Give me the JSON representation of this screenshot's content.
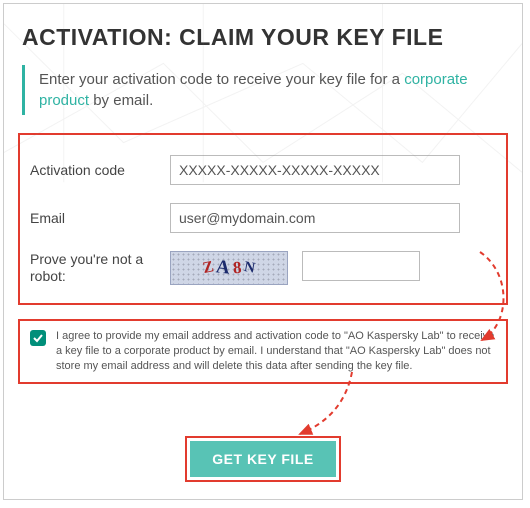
{
  "title": "ACTIVATION: CLAIM YOUR KEY FILE",
  "intro": {
    "before": "Enter your activation code to receive your key file for a ",
    "link": "corporate product",
    "after": " by email."
  },
  "form": {
    "activation": {
      "label": "Activation code",
      "value": "XXXXX-XXXXX-XXXXX-XXXXX"
    },
    "email": {
      "label": "Email",
      "value": "user@mydomain.com"
    },
    "captcha": {
      "label": "Prove you're not a robot:",
      "glyphs": {
        "z": "Z",
        "a": "A",
        "eight": "8",
        "n": "N"
      }
    }
  },
  "consent": {
    "checked": true,
    "text": "I agree to provide my email address and activation code to \"AO Kaspersky Lab\" to receive a key file to a corporate product by email. I understand that \"AO Kaspersky Lab\" does not store my email address and will delete this data after sending the key file."
  },
  "button": {
    "label": "GET KEY FILE"
  },
  "colors": {
    "accent": "#2fb3a3",
    "highlight": "#e23b2e",
    "checkbox": "#008f7a",
    "button": "#58c3b5"
  }
}
